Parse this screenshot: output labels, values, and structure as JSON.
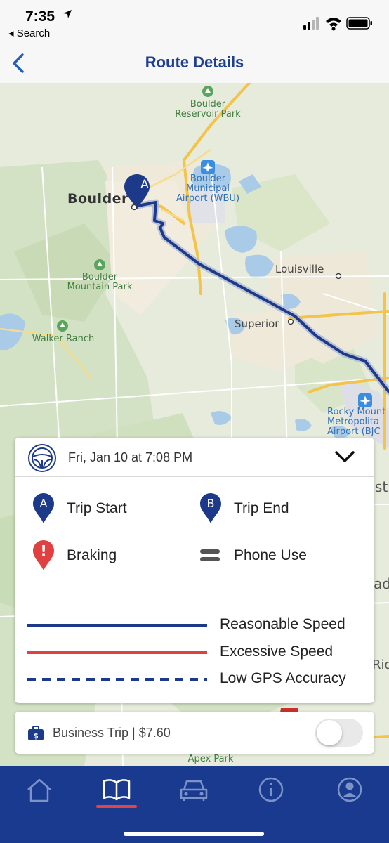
{
  "status_bar": {
    "time": "7:35",
    "back_label": "◂ Search",
    "icons": [
      "location-arrow-icon",
      "signal-icon",
      "wifi-icon",
      "battery-icon"
    ]
  },
  "nav": {
    "title": "Route Details",
    "back_icon": "chevron-left-icon"
  },
  "map": {
    "labels": {
      "boulder_reservoir": "Boulder\nReservoir Park",
      "boulder_airport": "Boulder\nMunicipal\nAirport (WBU)",
      "boulder": "Boulder",
      "boulder_mountain_park": "Boulder\nMountain Park",
      "louisville": "Louisville",
      "walker_ranch": "Walker Ranch",
      "superior": "Superior",
      "rocky_mountain_airport": "Rocky Mount\nMetropolita\nAirport (BJC",
      "apex_park": "Apex Park",
      "edge_st": "st",
      "edge_ad": "ad",
      "edge_rid": "Rid"
    },
    "start_marker": "A",
    "route_color": "#1d3a8a"
  },
  "trip": {
    "date": "Fri, Jan 10 at 7:08 PM",
    "expand_icon": "chevron-down-icon"
  },
  "legend": {
    "items": [
      {
        "label": "Trip Start",
        "marker": "A",
        "icon": "pin-a-icon"
      },
      {
        "label": "Trip End",
        "marker": "B",
        "icon": "pin-b-icon"
      },
      {
        "label": "Braking",
        "marker": "!",
        "icon": "braking-pin-icon"
      },
      {
        "label": "Phone Use",
        "icon": "phone-use-icon"
      }
    ],
    "lines": [
      {
        "label": "Reasonable Speed",
        "color": "#1d3a8a",
        "style": "solid"
      },
      {
        "label": "Excessive Speed",
        "color": "#e04040",
        "style": "solid"
      },
      {
        "label": "Low GPS Accuracy",
        "color": "#1d3a8a",
        "style": "dashed"
      }
    ]
  },
  "business": {
    "label": "Business Trip | $7.60",
    "toggle_on": false
  },
  "tabs": [
    {
      "name": "home",
      "icon": "home-icon",
      "active": false
    },
    {
      "name": "trips",
      "icon": "book-icon",
      "active": true
    },
    {
      "name": "vehicle",
      "icon": "car-icon",
      "active": false
    },
    {
      "name": "info",
      "icon": "info-icon",
      "active": false
    },
    {
      "name": "profile",
      "icon": "profile-icon",
      "active": false
    }
  ],
  "colors": {
    "brand_blue": "#1a3a8f",
    "title_blue": "#1f3f8f",
    "accent_red": "#e04545"
  }
}
